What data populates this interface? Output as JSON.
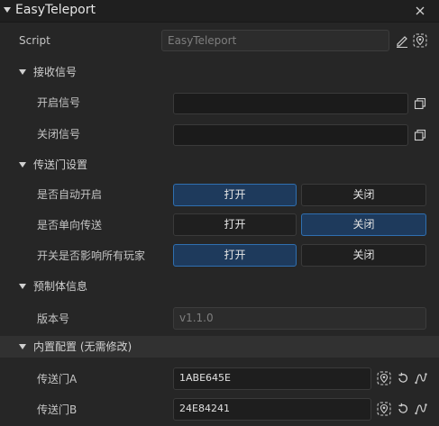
{
  "component": {
    "title": "EasyTeleport"
  },
  "script": {
    "label": "Script",
    "value": "EasyTeleport"
  },
  "receive_section": {
    "label": "接收信号",
    "open_signal": {
      "label": "开启信号",
      "value": ""
    },
    "close_signal": {
      "label": "关闭信号",
      "value": ""
    }
  },
  "portal_section": {
    "label": "传送门设置",
    "rows": [
      {
        "label": "是否自动开启",
        "on_label": "打开",
        "off_label": "关闭",
        "selected": "on"
      },
      {
        "label": "是否单向传送",
        "on_label": "打开",
        "off_label": "关闭",
        "selected": "off"
      },
      {
        "label": "开关是否影响所有玩家",
        "on_label": "打开",
        "off_label": "关闭",
        "selected": "on"
      }
    ]
  },
  "prefab_section": {
    "label": "预制体信息",
    "version": {
      "label": "版本号",
      "value": "v1.1.0"
    }
  },
  "builtin_section": {
    "label": "内置配置 (无需修改)",
    "portal_a": {
      "label": "传送门A",
      "value": "1ABE645E"
    },
    "portal_b": {
      "label": "传送门B",
      "value": "24E84241"
    }
  },
  "colors": {
    "background": "#262626",
    "selected_button": "#1e3a5c",
    "selected_border": "#2f6fb0"
  },
  "icons": [
    "caret-down-icon",
    "close-icon",
    "edit-icon",
    "locate-icon",
    "copy-icon",
    "reset-icon",
    "curve-icon"
  ]
}
